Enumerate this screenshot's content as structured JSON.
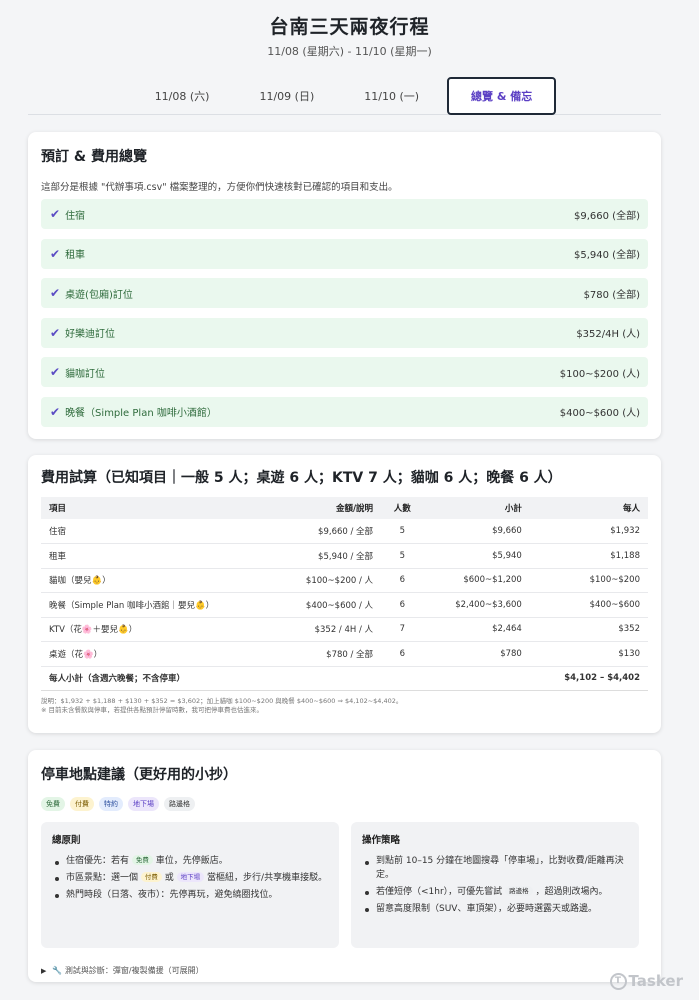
{
  "header": {
    "title": "台南三天兩夜行程",
    "subtitle": "11/08 (星期六) - 11/10 (星期一)"
  },
  "tabs": [
    {
      "label": "11/08 (六)",
      "active": false
    },
    {
      "label": "11/09 (日)",
      "active": false
    },
    {
      "label": "11/10 (一)",
      "active": false
    },
    {
      "label": "總覽 & 備忘",
      "active": true
    }
  ],
  "booking": {
    "title": "預訂 & 費用總覽",
    "description": "這部分是根據 \"代辦事項.csv\" 檔案整理的，方便你們快速核對已確認的項目和支出。",
    "check_icon": "check-icon",
    "items": [
      {
        "label": "住宿",
        "value": "$9,660 (全部)"
      },
      {
        "label": "租車",
        "value": "$5,940 (全部)"
      },
      {
        "label": "桌遊(包廂)訂位",
        "value": "$780 (全部)"
      },
      {
        "label": "好樂迪訂位",
        "value": "$352/4H (人)"
      },
      {
        "label": "貓咖訂位",
        "value": "$100~$200 (人)"
      },
      {
        "label": "晚餐（Simple Plan 咖啡小酒館）",
        "value": "$400~$600 (人)"
      }
    ]
  },
  "estimate": {
    "title": "費用試算（已知項目｜一般 5 人；桌遊 6 人；KTV 7 人；貓咖 6 人；晚餐 6 人）",
    "headers": [
      "項目",
      "金額/說明",
      "人數",
      "小計",
      "每人"
    ],
    "rows": [
      {
        "item": "住宿",
        "amount": "$9,660 / 全部",
        "people": "5",
        "subtotal": "$9,660",
        "per": "$1,932"
      },
      {
        "item": "租車",
        "amount": "$5,940 / 全部",
        "people": "5",
        "subtotal": "$5,940",
        "per": "$1,188"
      },
      {
        "item": "貓咖（嬰兒👶）",
        "amount": "$100~$200 / 人",
        "people": "6",
        "subtotal": "$600~$1,200",
        "per": "$100~$200"
      },
      {
        "item": "晚餐（Simple Plan 咖啡小酒館｜嬰兒👶）",
        "amount": "$400~$600 / 人",
        "people": "6",
        "subtotal": "$2,400~$3,600",
        "per": "$400~$600"
      },
      {
        "item": "KTV（花🌸＋嬰兒👶）",
        "amount": "$352 / 4H / 人",
        "people": "7",
        "subtotal": "$2,464",
        "per": "$352"
      },
      {
        "item": "桌遊（花🌸）",
        "amount": "$780 / 全部",
        "people": "6",
        "subtotal": "$780",
        "per": "$130"
      }
    ],
    "total": {
      "label": "每人小計（含週六晚餐；不含停車）",
      "value": "$4,102 – $4,402"
    },
    "note1": "說明：$1,932 + $1,188 + $130 + $352 = $3,602；加上貓咖 $100~$200 與晚餐 $400~$600 ⇒ $4,102~$4,402。",
    "note2": "※ 目前未含餐飲與停車，若提供各點預計停留時數，我可把停車費也估進來。"
  },
  "parking": {
    "title": "停車地點建議（更好用的小抄）",
    "tags": [
      {
        "label": "免費",
        "kind": "free"
      },
      {
        "label": "付費",
        "kind": "paid"
      },
      {
        "label": "特約",
        "kind": "special"
      },
      {
        "label": "地下場",
        "kind": "under"
      },
      {
        "label": "路邊格",
        "kind": "road"
      }
    ],
    "principles": {
      "title": "總原則",
      "item1_a": "住宿優先：若有",
      "item1_tag": "免費",
      "item1_b": "車位，先停飯店。",
      "item2_a": "市區景點：選一個",
      "item2_tag1": "付費",
      "item2_mid": "或",
      "item2_tag2": "地下場",
      "item2_b": "當樞紐，步行/共享機車接駁。",
      "item3": "熱門時段（日落、夜市）：先停再玩，避免繞圈找位。"
    },
    "strategy": {
      "title": "操作策略",
      "item1": "到點前 10–15 分鐘在地圖搜尋「停車場」，比對收費/距離再決定。",
      "item2_a": "若僅短停（<1hr），可優先嘗試",
      "item2_tag": "路邊格",
      "item2_b": "，超過則改場內。",
      "item3": "留意高度限制（SUV、車頂架），必要時選露天或路邊。"
    },
    "details": "🔧 測試與診斷：彈窗/複製備援（可展開）"
  },
  "watermark": "Tasker"
}
